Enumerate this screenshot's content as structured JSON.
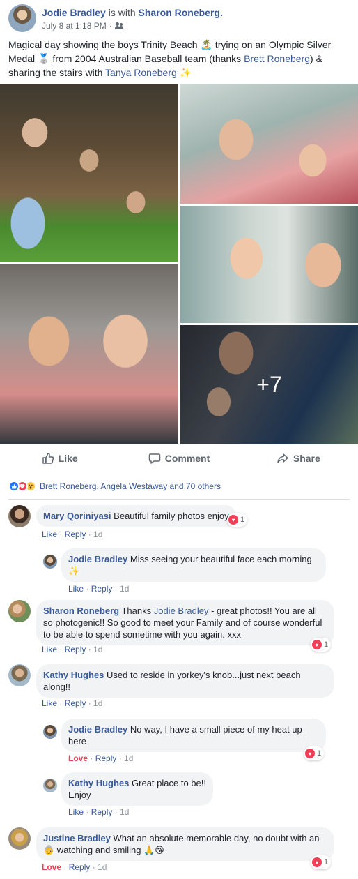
{
  "post": {
    "author": "Jodie Bradley",
    "with_text": " is with ",
    "tagged": "Sharon Roneberg.",
    "timestamp": "July 8 at 1:18 PM",
    "dot": "·",
    "privacy_icon": "friends-icon",
    "text_1": "Magical day showing the boys Trinity Beach ",
    "emoji_beach": "🏝️",
    "text_2": " trying on an Olympic Silver Medal ",
    "emoji_medal": "🥈",
    "text_3": " from 2004 Australian Baseball team (thanks ",
    "mention_1": "Brett Roneberg",
    "text_4": ") & sharing the stairs with ",
    "mention_2": "Tanya Roneberg",
    "emoji_sparkle": "✨"
  },
  "photos": {
    "more_count": "+7"
  },
  "actions": {
    "like": "Like",
    "comment": "Comment",
    "share": "Share"
  },
  "reactions": {
    "summary": "Brett Roneberg, Angela Westaway and 70 others",
    "icons": [
      "like",
      "love",
      "wow"
    ]
  },
  "comments": [
    {
      "author": "Mary Qoriniyasi",
      "text": "Beautiful family photos enjoy",
      "like": "Like",
      "reply": "Reply",
      "time": "1d",
      "reaction_count": "1"
    },
    {
      "author": "Jodie Bradley",
      "text": "Miss seeing your beautiful face each morning",
      "emoji": "✨",
      "like": "Like",
      "reply": "Reply",
      "time": "1d"
    },
    {
      "author": "Sharon Roneberg",
      "text_1": "Thanks ",
      "mention": "Jodie Bradley",
      "text_2": " - great photos!! You are all so photogenic!! So good to meet your Family and of course wonderful to be able to spend sometime with you again. xxx",
      "like": "Like",
      "reply": "Reply",
      "time": "1d",
      "reaction_count": "1"
    },
    {
      "author": "Kathy Hughes",
      "text": "Used to reside in yorkey's knob...just next beach along!!",
      "like": "Like",
      "reply": "Reply",
      "time": "1d"
    },
    {
      "author": "Jodie Bradley",
      "text": "No way, I have a small piece of my heat up here",
      "like": "Love",
      "reply": "Reply",
      "time": "1d",
      "reaction_count": "1"
    },
    {
      "author": "Kathy Hughes",
      "text": "Great place to be!! Enjoy",
      "like": "Like",
      "reply": "Reply",
      "time": "1d"
    },
    {
      "author": "Justine Bradley",
      "text_1": "What an absolute memorable day, no doubt with an ",
      "emoji_1": "👵",
      "text_2": " watching and smiling ",
      "emoji_2": "🙏😘",
      "like": "Love",
      "reply": "Reply",
      "time": "1d",
      "reaction_count": "1"
    }
  ],
  "colors": {
    "link": "#385898",
    "love": "#f33e58",
    "like": "#2078f4",
    "bubble": "#f2f3f5"
  }
}
